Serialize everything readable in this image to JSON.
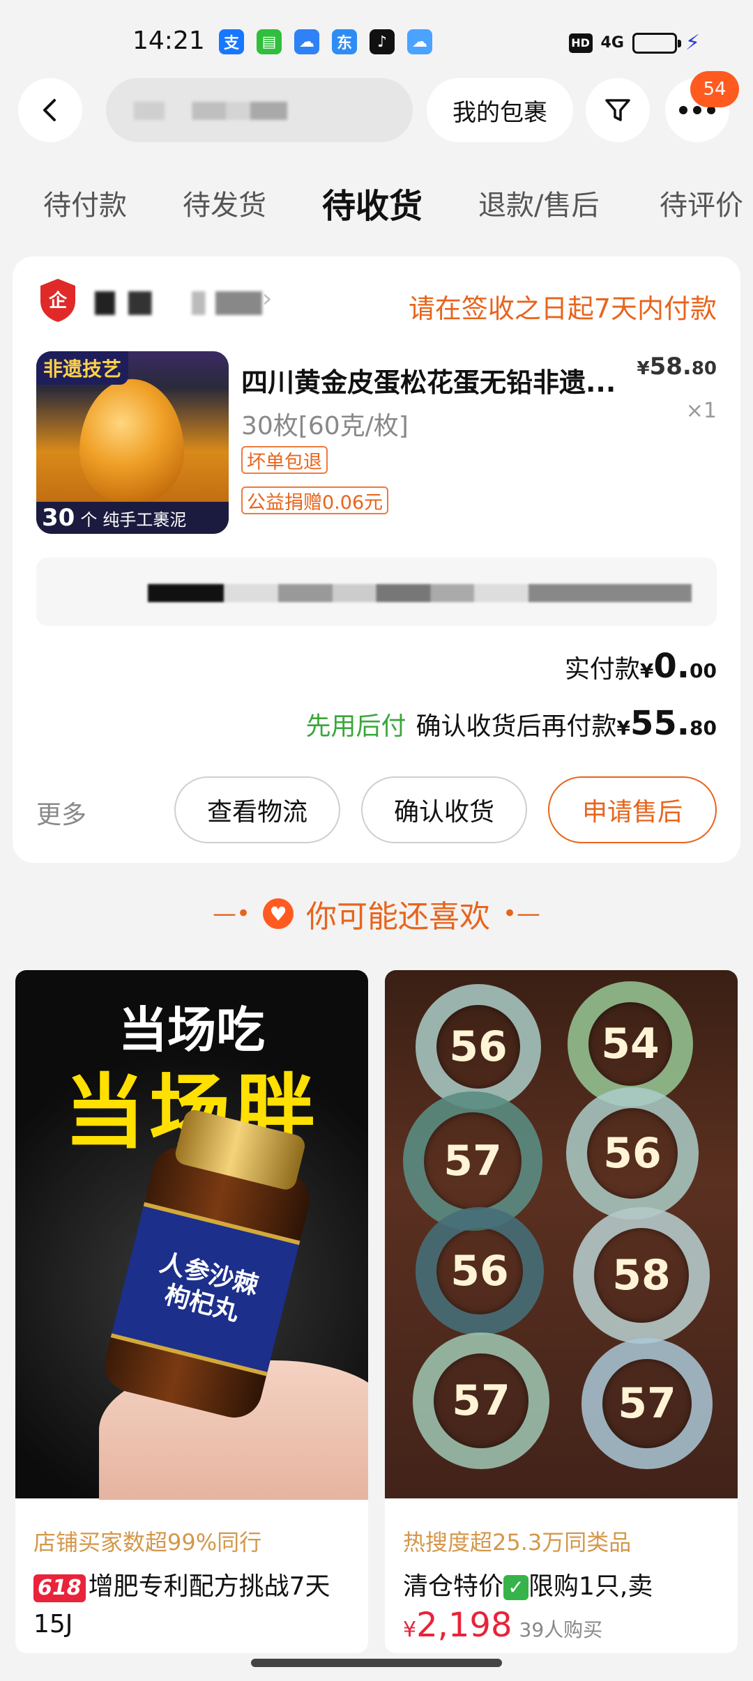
{
  "status_bar": {
    "time": "14:21",
    "app_icons": [
      {
        "icon": "alipay-icon",
        "glyph": "支",
        "color": "#1677ff"
      },
      {
        "icon": "message-icon",
        "glyph": "▤",
        "color": "#2fbf3c"
      },
      {
        "icon": "cloud-service-icon",
        "glyph": "☁",
        "color": "#2f82f6"
      },
      {
        "icon": "jd-icon",
        "glyph": "东",
        "color": "#2e8df5"
      },
      {
        "icon": "tiktok-icon",
        "glyph": "♪",
        "color": "#111111"
      },
      {
        "icon": "weather-icon",
        "glyph": "☁",
        "color": "#4aa3ff"
      }
    ],
    "hd": "HD",
    "network": "4G"
  },
  "header": {
    "my_package_label": "我的包裹",
    "more_badge": "54"
  },
  "tabs": [
    {
      "label": "待付款",
      "active": false
    },
    {
      "label": "待发货",
      "active": false
    },
    {
      "label": "待收货",
      "active": true
    },
    {
      "label": "退款/售后",
      "active": false
    },
    {
      "label": "待评价",
      "active": false
    }
  ],
  "order": {
    "shop_logo_glyph": "企",
    "pay_note": "请在签收之日起7天内付款",
    "thumb_tag_top": "非遗技艺",
    "thumb_tag_count": "30",
    "thumb_tag_unit": "个",
    "thumb_tag_text": "纯手工裹泥",
    "product_title": "四川黄金皮蛋松花蛋无铅非遗...",
    "price_yen": "¥",
    "price_int": "58.",
    "price_dec": "80",
    "spec": "30枚[60克/枚]",
    "qty": "×1",
    "tags": [
      "坏单包退",
      "公益捐赠0.06元"
    ],
    "paid_label": "实付款",
    "paid_yen": "¥",
    "paid_int": "0.",
    "paid_dec": "00",
    "paylater_label": "先用后付",
    "paylater_text": "确认收货后再付款",
    "paylater_yen": "¥",
    "paylater_int": "55.",
    "paylater_dec": "80",
    "more": "更多",
    "buttons": {
      "logistics": "查看物流",
      "confirm": "确认收货",
      "after_sale": "申请售后"
    }
  },
  "recommend": {
    "title": "你可能还喜欢",
    "items": [
      {
        "img_line1": "当场吃",
        "img_line2": "当场胖",
        "bottle_label_1": "人参沙棘",
        "bottle_label_2": "枸杞丸",
        "subtitle": "店铺买家数超99%同行",
        "badge": "618",
        "name": "增肥专利配方挑战7天15J"
      },
      {
        "bangle_numbers": [
          "56",
          "54",
          "57",
          "56",
          "56",
          "58",
          "57",
          "57"
        ],
        "subtitle": "热搜度超25.3万同类品",
        "name_a": "清仓特价",
        "check": "✓",
        "name_b": "限购1只,卖",
        "price_yen": "¥",
        "price": "2,198",
        "sold": "39人购买"
      }
    ]
  }
}
